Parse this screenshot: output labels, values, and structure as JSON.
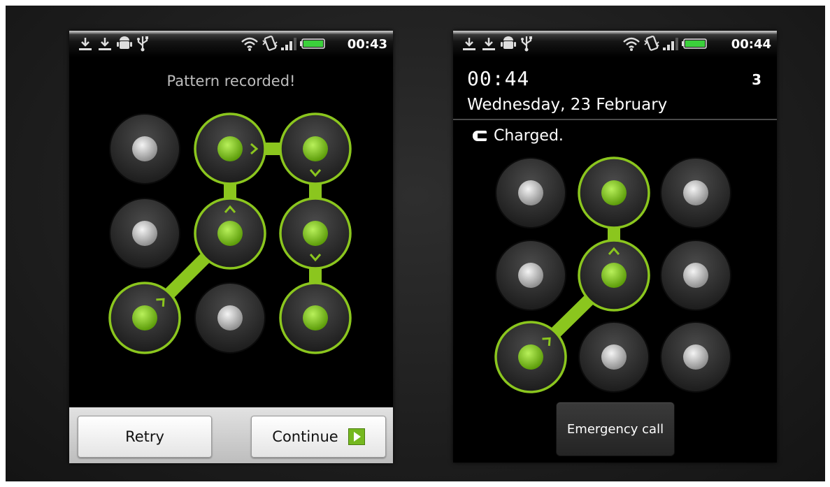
{
  "phone1": {
    "status_time": "00:43",
    "title": "Pattern recorded!",
    "retry_label": "Retry",
    "continue_label": "Continue",
    "pattern": [
      6,
      4,
      1,
      2,
      5,
      8
    ],
    "accent": "#8bc61e"
  },
  "phone2": {
    "status_time": "00:44",
    "clock": "00:44",
    "count": "3",
    "date": "Wednesday, 23 February",
    "charge_status": "Charged.",
    "emergency_label": "Emergency call",
    "pattern": [
      6,
      4,
      1
    ],
    "accent": "#8bc61e"
  },
  "status_icons": [
    "download-icon",
    "download-icon",
    "android-icon",
    "usb-icon",
    "wifi-icon",
    "vibrate-icon",
    "signal-icon",
    "battery-icon"
  ]
}
